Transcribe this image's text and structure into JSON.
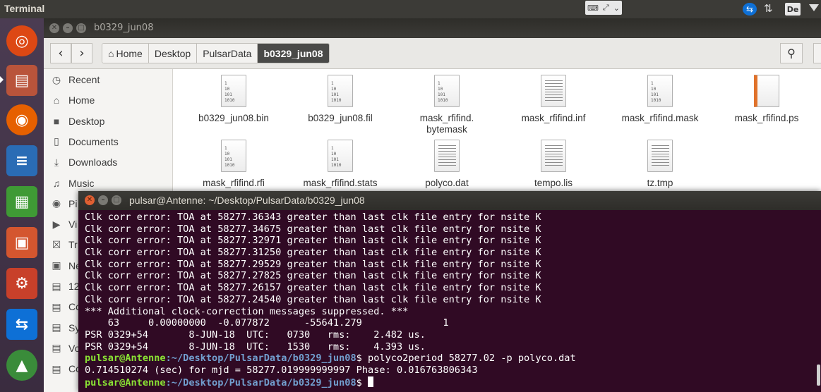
{
  "top_panel": {
    "app_title": "Terminal",
    "lang": "De"
  },
  "launcher": {
    "items": [
      {
        "icon": "ubuntu-dash-icon",
        "color": "#dd4814"
      },
      {
        "icon": "file-manager-icon",
        "color": "#b9543b"
      },
      {
        "icon": "firefox-icon",
        "color": "#e66000"
      },
      {
        "icon": "libreoffice-writer-icon",
        "color": "#2a6cb5"
      },
      {
        "icon": "libreoffice-calc-icon",
        "color": "#3f9a35"
      },
      {
        "icon": "libreoffice-impress-icon",
        "color": "#d4562f"
      },
      {
        "icon": "system-settings-icon",
        "color": "#c8402a"
      },
      {
        "icon": "teamviewer-icon",
        "color": "#0e70d6"
      },
      {
        "icon": "software-updater-icon",
        "color": "#3a8c3a"
      }
    ]
  },
  "file_manager": {
    "title": "b0329_jun08",
    "breadcrumbs": [
      {
        "label": "Home"
      },
      {
        "label": "Desktop"
      },
      {
        "label": "PulsarData"
      },
      {
        "label": "b0329_jun08"
      }
    ],
    "sidebar": [
      {
        "label": "Recent",
        "icon": "clock-icon",
        "glyph": "◷"
      },
      {
        "label": "Home",
        "icon": "home-icon",
        "glyph": "⌂"
      },
      {
        "label": "Desktop",
        "icon": "desktop-folder-icon",
        "glyph": "■"
      },
      {
        "label": "Documents",
        "icon": "document-icon",
        "glyph": "▯"
      },
      {
        "label": "Downloads",
        "icon": "download-icon",
        "glyph": "⤓"
      },
      {
        "label": "Music",
        "icon": "music-icon",
        "glyph": "♫"
      },
      {
        "label": "Pi",
        "icon": "camera-icon",
        "glyph": "◉"
      },
      {
        "label": "Vi",
        "icon": "video-icon",
        "glyph": "▶"
      },
      {
        "label": "Tr",
        "icon": "trash-icon",
        "glyph": "☒"
      },
      {
        "label": "Ne",
        "icon": "network-icon",
        "glyph": "▣"
      },
      {
        "label": "12",
        "icon": "drive-icon",
        "glyph": "▤"
      },
      {
        "label": "Co",
        "icon": "drive-icon",
        "glyph": "▤"
      },
      {
        "label": "Sy",
        "icon": "drive-icon",
        "glyph": "▤"
      },
      {
        "label": "Vo",
        "icon": "drive-icon",
        "glyph": "▤"
      },
      {
        "label": "Co",
        "icon": "drive-icon",
        "glyph": "▤"
      }
    ],
    "files": [
      {
        "name": "b0329_jun08.bin",
        "kind": "bin"
      },
      {
        "name": "b0329_jun08.fil",
        "kind": "bin"
      },
      {
        "name": "mask_rfifind.\nbytemask",
        "kind": "bin"
      },
      {
        "name": "mask_rfifind.inf",
        "kind": "txt"
      },
      {
        "name": "mask_rfifind.mask",
        "kind": "bin"
      },
      {
        "name": "mask_rfifind.ps",
        "kind": "ps"
      },
      {
        "name": "mask_rfifind.rfi",
        "kind": "bin"
      },
      {
        "name": "mask_rfifind.stats",
        "kind": "bin"
      },
      {
        "name": "polyco.dat",
        "kind": "txt"
      },
      {
        "name": "tempo.lis",
        "kind": "txt"
      },
      {
        "name": "tz.tmp",
        "kind": "txt"
      }
    ]
  },
  "terminal": {
    "title": "pulsar@Antenne: ~/Desktop/PulsarData/b0329_jun08",
    "lines": [
      "Clk corr error: TOA at 58277.36343 greater than last clk file entry for nsite K",
      "Clk corr error: TOA at 58277.34675 greater than last clk file entry for nsite K",
      "Clk corr error: TOA at 58277.32971 greater than last clk file entry for nsite K",
      "Clk corr error: TOA at 58277.31250 greater than last clk file entry for nsite K",
      "Clk corr error: TOA at 58277.29529 greater than last clk file entry for nsite K",
      "Clk corr error: TOA at 58277.27825 greater than last clk file entry for nsite K",
      "Clk corr error: TOA at 58277.26157 greater than last clk file entry for nsite K",
      "Clk corr error: TOA at 58277.24540 greater than last clk file entry for nsite K",
      "*** Additional clock-correction messages suppressed. ***",
      "    63     0.00000000  -0.077872      -55641.279              1",
      "PSR 0329+54       8-JUN-18  UTC:   0730   rms:    2.482 us.",
      "PSR 0329+54       8-JUN-18  UTC:   1530   rms:    4.393 us."
    ],
    "prompt_user": "pulsar@Antenne",
    "prompt_path": ":~/Desktop/PulsarData/b0329_jun08",
    "prompt_symbol": "$",
    "command": " polyco2period 58277.02 -p polyco.dat",
    "output": "0.714510274 (sec) for mjd = 58277.019999999997 Phase: 0.016763806343"
  }
}
